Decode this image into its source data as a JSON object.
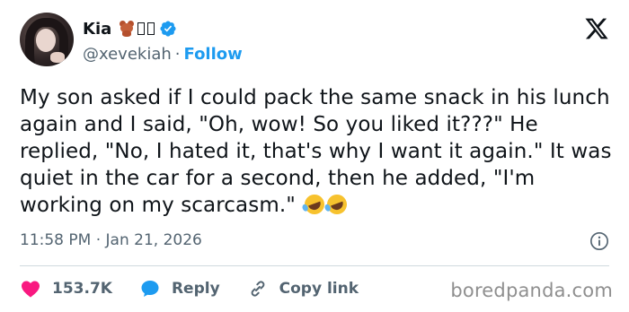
{
  "tweet": {
    "author": {
      "display_name": "Kia",
      "handle": "@xevekiah",
      "follow_label": "Follow",
      "separator": "·"
    },
    "text": "My son asked if I could pack the same snack in his lunch again and I said, \"Oh, wow! So you liked it???\" He replied, \"No, I hated it, that's why I want it again.\" It was quiet in the car for a second, then he added, \"I'm working on my scarcasm.\"",
    "time": "11:58 PM",
    "time_separator": "·",
    "date": "Jan 21, 2026",
    "actions": {
      "likes": "153.7K",
      "reply_label": "Reply",
      "copy_link_label": "Copy link"
    }
  },
  "watermark": "boredpanda.com",
  "icons": {
    "platform_logo": "x-logo-icon",
    "verified": "verified-badge-icon",
    "like": "heart-icon",
    "reply": "speech-bubble-icon",
    "copy_link": "link-icon",
    "info": "info-icon"
  },
  "colors": {
    "accent": "#1d9bf0",
    "like": "#f91880",
    "text_primary": "#0f1419",
    "text_secondary": "#536471",
    "divider": "#cfd9de"
  }
}
